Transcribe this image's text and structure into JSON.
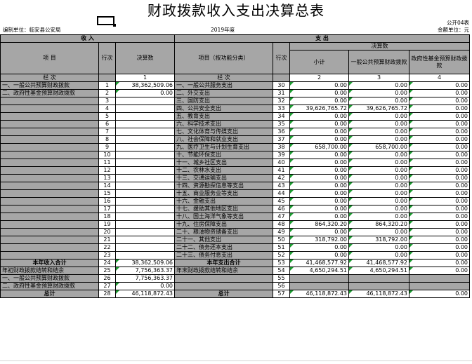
{
  "title": "财政拨款收入支出决算总表",
  "form_no": "公开04表",
  "unit": "编制单位：临安县公安局",
  "year": "2019年度",
  "currency": "金额单位：元",
  "header": {
    "income": "收    入",
    "expense": "支    出",
    "item": "项    目",
    "row_no": "行次",
    "final": "决算数",
    "item_func": "项目（按功能分类）",
    "final_amount": "决算数",
    "subtotal": "小计",
    "general": "一般公共预算财政拨款",
    "fund": "政府性基金预算财政拨款",
    "lanci": "栏    次",
    "col1": "1",
    "col2": "2",
    "col3": "3",
    "col4": "4"
  },
  "rows": [
    {
      "li": "一、一般公共预算财政拨款",
      "ln": "1",
      "lv": "38,362,509.06",
      "ri": "一、一般公共服务支出",
      "rn": "30",
      "s": "0.00",
      "gn": "0.00",
      "fd": "0.00"
    },
    {
      "li": "二、政府性基金预算财政拨款",
      "ln": "2",
      "lv": "0.00",
      "ri": "二、外交支出",
      "rn": "31",
      "s": "0.00",
      "gn": "0.00",
      "fd": "0.00"
    },
    {
      "li": "",
      "ln": "3",
      "lv": "",
      "ri": "三、国防支出",
      "rn": "32",
      "s": "0.00",
      "gn": "0.00",
      "fd": "0.00"
    },
    {
      "li": "",
      "ln": "4",
      "lv": "",
      "ri": "四、公共安全支出",
      "rn": "33",
      "s": "39,626,765.72",
      "gn": "39,626,765.72",
      "fd": "0.00"
    },
    {
      "li": "",
      "ln": "5",
      "lv": "",
      "ri": "五、教育支出",
      "rn": "34",
      "s": "0.00",
      "gn": "0.00",
      "fd": "0.00"
    },
    {
      "li": "",
      "ln": "6",
      "lv": "",
      "ri": "六、科学技术支出",
      "rn": "35",
      "s": "0.00",
      "gn": "0.00",
      "fd": "0.00"
    },
    {
      "li": "",
      "ln": "7",
      "lv": "",
      "ri": "七、文化体育与传媒支出",
      "rn": "36",
      "s": "0.00",
      "gn": "0.00",
      "fd": "0.00"
    },
    {
      "li": "",
      "ln": "8",
      "lv": "",
      "ri": "八、社会保障和就业支出",
      "rn": "37",
      "s": "0.00",
      "gn": "0.00",
      "fd": "0.00"
    },
    {
      "li": "",
      "ln": "9",
      "lv": "",
      "ri": "九、医疗卫生与计划生育支出",
      "rn": "38",
      "s": "658,700.00",
      "gn": "658,700.00",
      "fd": "0.00"
    },
    {
      "li": "",
      "ln": "10",
      "lv": "",
      "ri": "十、节能环保支出",
      "rn": "39",
      "s": "0.00",
      "gn": "0.00",
      "fd": "0.00"
    },
    {
      "li": "",
      "ln": "11",
      "lv": "",
      "ri": "十一、城乡社区支出",
      "rn": "40",
      "s": "0.00",
      "gn": "0.00",
      "fd": "0.00"
    },
    {
      "li": "",
      "ln": "12",
      "lv": "",
      "ri": "十二、农林水支出",
      "rn": "41",
      "s": "0.00",
      "gn": "0.00",
      "fd": "0.00"
    },
    {
      "li": "",
      "ln": "13",
      "lv": "",
      "ri": "十三、交通运输支出",
      "rn": "42",
      "s": "0.00",
      "gn": "0.00",
      "fd": "0.00"
    },
    {
      "li": "",
      "ln": "14",
      "lv": "",
      "ri": "十四、资源勘探信息等支出",
      "rn": "43",
      "s": "0.00",
      "gn": "0.00",
      "fd": "0.00"
    },
    {
      "li": "",
      "ln": "15",
      "lv": "",
      "ri": "十五、商业服务业等支出",
      "rn": "44",
      "s": "0.00",
      "gn": "0.00",
      "fd": "0.00"
    },
    {
      "li": "",
      "ln": "16",
      "lv": "",
      "ri": "十六、金融支出",
      "rn": "45",
      "s": "0.00",
      "gn": "0.00",
      "fd": "0.00"
    },
    {
      "li": "",
      "ln": "17",
      "lv": "",
      "ri": "十七、援助其他地区支出",
      "rn": "46",
      "s": "0.00",
      "gn": "0.00",
      "fd": "0.00"
    },
    {
      "li": "",
      "ln": "18",
      "lv": "",
      "ri": "十八、国土海洋气象等支出",
      "rn": "47",
      "s": "0.00",
      "gn": "0.00",
      "fd": "0.00"
    },
    {
      "li": "",
      "ln": "19",
      "lv": "",
      "ri": "十九、住房保障支出",
      "rn": "48",
      "s": "864,320.20",
      "gn": "864,320.20",
      "fd": "0.00"
    },
    {
      "li": "",
      "ln": "20",
      "lv": "",
      "ri": "二十、粮油物资储备支出",
      "rn": "49",
      "s": "0.00",
      "gn": "0.00",
      "fd": "0.00"
    },
    {
      "li": "",
      "ln": "21",
      "lv": "",
      "ri": "二十一、其他支出",
      "rn": "50",
      "s": "318,792.00",
      "gn": "318,792.00",
      "fd": "0.00"
    },
    {
      "li": "",
      "ln": "22",
      "lv": "",
      "ri": "二十二、债务还本支出",
      "rn": "51",
      "s": "0.00",
      "gn": "0.00",
      "fd": "0.00"
    },
    {
      "li": "",
      "ln": "23",
      "lv": "",
      "ri": "二十三、债务付息支出",
      "rn": "52",
      "s": "0.00",
      "gn": "0.00",
      "fd": "0.00"
    }
  ],
  "summary": {
    "income_total_label": "本年收入合计",
    "income_total_no": "24",
    "income_total_val": "38,362,509.06",
    "expense_total_label": "本年支出合计",
    "expense_total_no": "53",
    "expense_total_s": "41,468,577.92",
    "expense_total_gn": "41,468,577.92",
    "expense_total_fd": "0.00",
    "begin_label": "年初财政拨款结转和结余",
    "begin_no": "25",
    "begin_val": "7,756,363.37",
    "end_label": "年末财政拨款结转和结余",
    "end_no": "54",
    "end_s": "4,650,294.51",
    "end_gn": "4,650,294.51",
    "end_fd": "0.00",
    "b1_label": "一、一般公共预算财政拨款",
    "b1_no": "26",
    "b1_val": "7,756,363.37",
    "b1_rno": "55",
    "b2_label": "二、政府性基金预算财政拨款",
    "b2_no": "27",
    "b2_val": "0.00",
    "b2_rno": "56",
    "total_label": "总计",
    "total_no": "28",
    "total_val": "46,118,872.43",
    "total_rlabel": "总计",
    "total_rno": "57",
    "total_s": "46,118,872.43",
    "total_gn": "46,118,872.43",
    "total_fd": "0.00"
  }
}
